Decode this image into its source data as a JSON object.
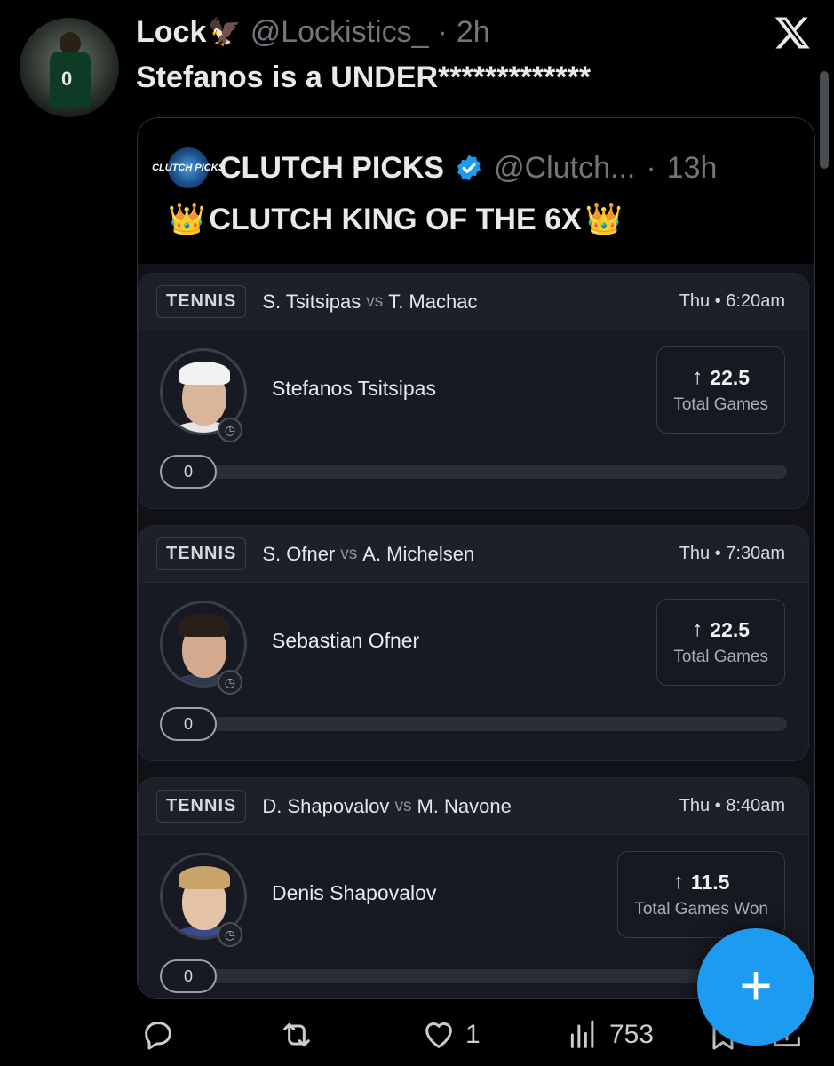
{
  "tweet": {
    "author_name": "Lock",
    "author_emoji": "🦅",
    "handle": "@Lockistics_",
    "separator": "·",
    "time": "2h",
    "text": "Stefanos is a UNDER*************"
  },
  "quote": {
    "name": "CLUTCH PICKS",
    "logo_text": "CLUTCH PICKS",
    "handle": "@Clutch...",
    "separator": "·",
    "time": "13h",
    "crown": "👑",
    "text": "CLUTCH KING OF THE 6X"
  },
  "picks": [
    {
      "sport": "TENNIS",
      "player_a": "S. Tsitsipas",
      "vs": "vs",
      "player_b": "T. Machac",
      "time": "Thu • 6:20am",
      "player_name": "Stefanos Tsitsipas",
      "arrow": "↑",
      "line": "22.5",
      "stat": "Total Games",
      "progress_label": "0",
      "progress": 0
    },
    {
      "sport": "TENNIS",
      "player_a": "S. Ofner",
      "vs": "vs",
      "player_b": "A. Michelsen",
      "time": "Thu • 7:30am",
      "player_name": "Sebastian Ofner",
      "arrow": "↑",
      "line": "22.5",
      "stat": "Total Games",
      "progress_label": "0",
      "progress": 0
    },
    {
      "sport": "TENNIS",
      "player_a": "D. Shapovalov",
      "vs": "vs",
      "player_b": "M. Navone",
      "time": "Thu • 8:40am",
      "player_name": "Denis Shapovalov",
      "arrow": "↑",
      "line": "11.5",
      "stat": "Total Games Won",
      "progress_label": "0",
      "progress": 0
    }
  ],
  "actions": {
    "reply_icon": "reply-icon",
    "repost_icon": "repost-icon",
    "like_icon": "heart-icon",
    "like_count": "1",
    "views_icon": "views-icon",
    "views_count": "753",
    "bookmark_icon": "bookmark-icon",
    "share_icon": "share-icon"
  },
  "fab": {
    "label": "+",
    "color": "#1d9bf0"
  },
  "colors": {
    "accent": "#1d9bf0",
    "muted": "#71767b",
    "card_bg": "#171a22"
  }
}
